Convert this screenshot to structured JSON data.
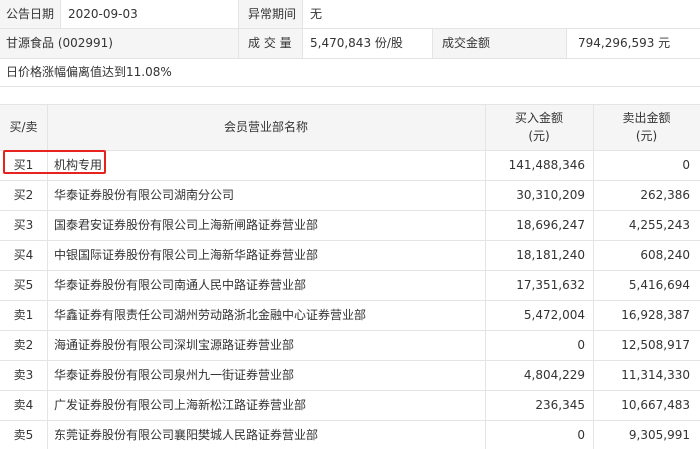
{
  "info": {
    "date_label": "公告日期",
    "date_value": "2020-09-03",
    "abnormal_label": "异常期间",
    "abnormal_value": "无",
    "stock_name": "甘源食品 (002991)",
    "volume_label": "成 交 量",
    "volume_value": "5,470,843 份/股",
    "amount_label": "成交金额",
    "amount_value": "794,296,593 元",
    "reason": "日价格涨幅偏离值达到11.08%"
  },
  "table": {
    "headers": {
      "side": "买/卖",
      "name": "会员营业部名称",
      "buy_line1": "买入金额",
      "buy_line2": "(元)",
      "sell_line1": "卖出金额",
      "sell_line2": "(元)"
    },
    "rows": [
      {
        "side": "买1",
        "name": "机构专用",
        "buy": "141,488,346",
        "sell": "0"
      },
      {
        "side": "买2",
        "name": "华泰证券股份有限公司湖南分公司",
        "buy": "30,310,209",
        "sell": "262,386"
      },
      {
        "side": "买3",
        "name": "国泰君安证券股份有限公司上海新闸路证券营业部",
        "buy": "18,696,247",
        "sell": "4,255,243"
      },
      {
        "side": "买4",
        "name": "中银国际证券股份有限公司上海新华路证券营业部",
        "buy": "18,181,240",
        "sell": "608,240"
      },
      {
        "side": "买5",
        "name": "华泰证券股份有限公司南通人民中路证券营业部",
        "buy": "17,351,632",
        "sell": "5,416,694"
      },
      {
        "side": "卖1",
        "name": "华鑫证券有限责任公司湖州劳动路浙北金融中心证券营业部",
        "buy": "5,472,004",
        "sell": "16,928,387"
      },
      {
        "side": "卖2",
        "name": "海通证券股份有限公司深圳宝源路证券营业部",
        "buy": "0",
        "sell": "12,508,917"
      },
      {
        "side": "卖3",
        "name": "华泰证券股份有限公司泉州九一街证券营业部",
        "buy": "4,804,229",
        "sell": "11,314,330"
      },
      {
        "side": "卖4",
        "name": "广发证券股份有限公司上海新松江路证券营业部",
        "buy": "236,345",
        "sell": "10,667,483"
      },
      {
        "side": "卖5",
        "name": "东莞证券股份有限公司襄阳樊城人民路证券营业部",
        "buy": "0",
        "sell": "9,305,991"
      }
    ]
  }
}
